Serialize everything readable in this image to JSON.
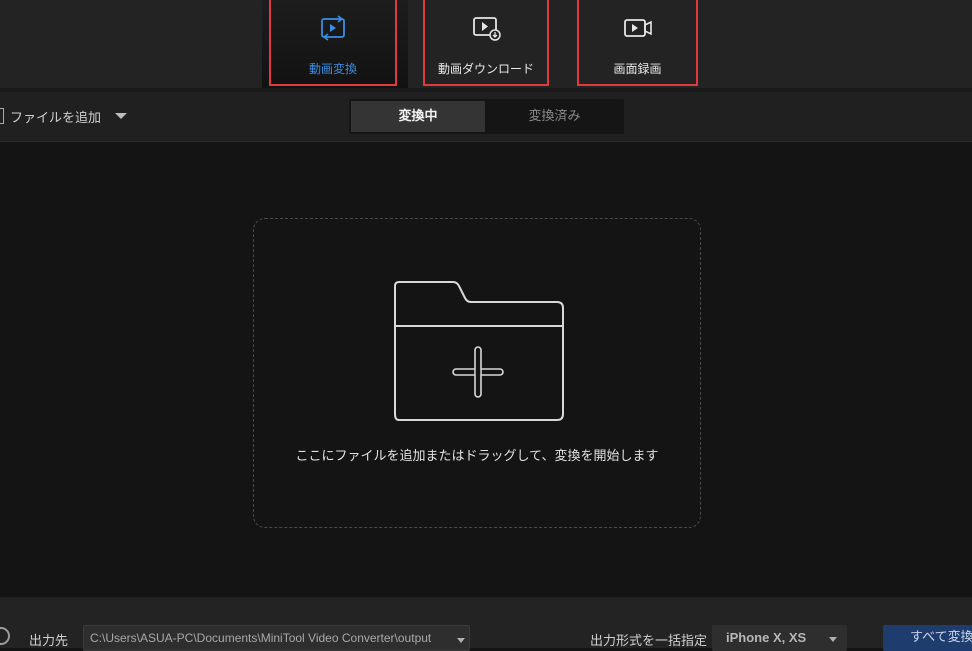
{
  "top_tabs": {
    "convert": {
      "label": "動画変換",
      "icon": "convert-video-icon",
      "active": true
    },
    "download": {
      "label": "動画ダウンロード",
      "icon": "download-video-icon"
    },
    "record": {
      "label": "画面録画",
      "icon": "screen-record-icon"
    }
  },
  "toolbar": {
    "add_file_label": "ファイルを追加",
    "segments": {
      "converting": "変換中",
      "converted": "変換済み"
    }
  },
  "dropzone": {
    "text": "ここにファイルを追加またはドラッグして、変換を開始します",
    "icon": "folder-add-icon"
  },
  "footer": {
    "output_label": "出力先",
    "output_path": "C:\\Users\\ASUA-PC\\Documents\\MiniTool Video Converter\\output",
    "format_label": "出力形式を一括指定",
    "format_value": "iPhone X, XS",
    "convert_all_label": "すべて変換"
  },
  "colors": {
    "accent_blue": "#3a8ee6",
    "highlight_red": "#e0393e",
    "background": "#141414"
  }
}
